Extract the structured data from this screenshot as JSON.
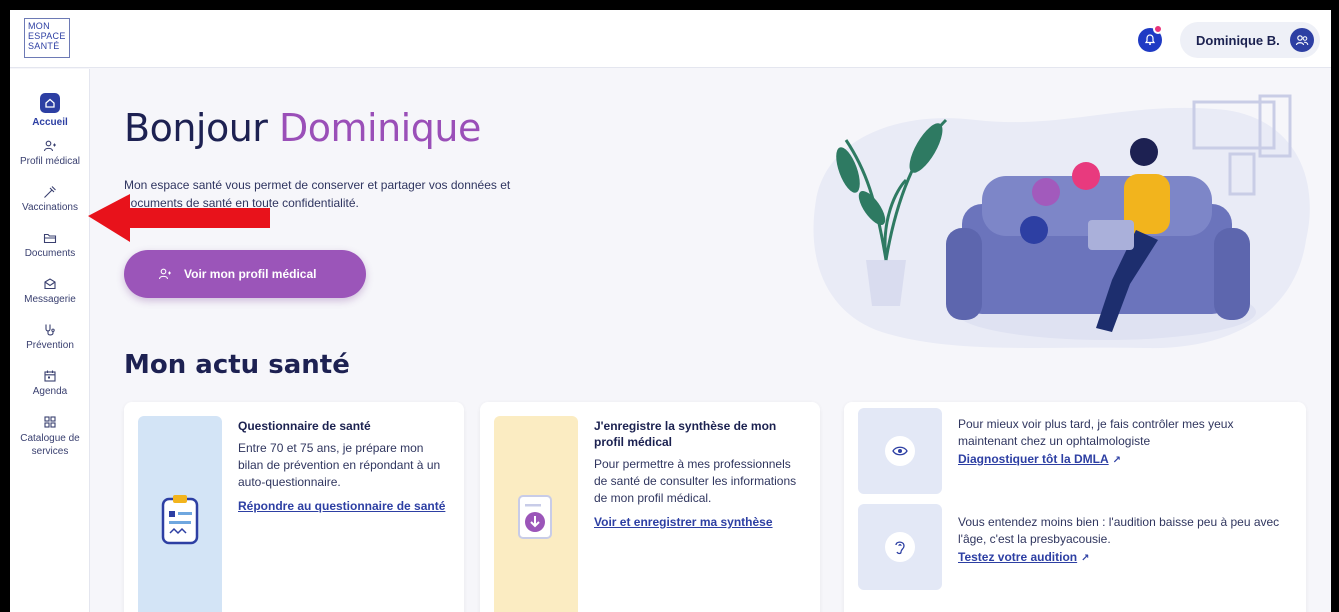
{
  "header": {
    "logo": [
      "MON",
      "ESPACE",
      "SANTÉ"
    ],
    "notification_icon": "bell-icon",
    "user_name": "Dominique B.",
    "user_icon": "person-icon"
  },
  "sidebar": {
    "items": [
      {
        "label": "Accueil",
        "icon": "home-icon",
        "active": true
      },
      {
        "label": "Profil médical",
        "icon": "person-plus-icon"
      },
      {
        "label": "Vaccinations",
        "icon": "syringe-icon"
      },
      {
        "label": "Documents",
        "icon": "folder-icon"
      },
      {
        "label": "Messagerie",
        "icon": "mail-icon"
      },
      {
        "label": "Prévention",
        "icon": "stethoscope-icon"
      },
      {
        "label": "Agenda",
        "icon": "calendar-icon"
      },
      {
        "label": "Catalogue de services",
        "icon": "grid-icon"
      }
    ]
  },
  "hero": {
    "greeting": "Bonjour",
    "name": "Dominique",
    "description": "Mon espace santé vous permet de conserver et partager vos données et documents de santé en toute confidentialité.",
    "cta_label": "Voir mon profil médical"
  },
  "news": {
    "title": "Mon actu santé",
    "cards": [
      {
        "title": "Questionnaire de santé",
        "text": "Entre 70 et 75 ans, je prépare mon bilan de prévention en répondant à un auto-questionnaire.",
        "link": "Répondre au questionnaire de santé"
      },
      {
        "title": "J'enregistre la synthèse de mon profil médical",
        "text": "Pour permettre à mes professionnels de santé de consulter les informations de mon profil médical.",
        "link": "Voir et enregistrer ma synthèse"
      }
    ],
    "tips": [
      {
        "text": "Pour mieux voir plus tard, je fais contrôler mes yeux maintenant chez un ophtalmologiste",
        "link": "Diagnostiquer tôt la DMLA",
        "icon": "eye-icon"
      },
      {
        "text": "Vous entendez moins bien : l'audition baisse peu à peu avec l'âge, c'est la presbyacousie.",
        "link": "Testez votre audition",
        "icon": "ear-icon"
      }
    ]
  },
  "colors": {
    "primary": "#2d3fa3",
    "accent": "#9b55b9",
    "arrow": "#e8121b"
  }
}
